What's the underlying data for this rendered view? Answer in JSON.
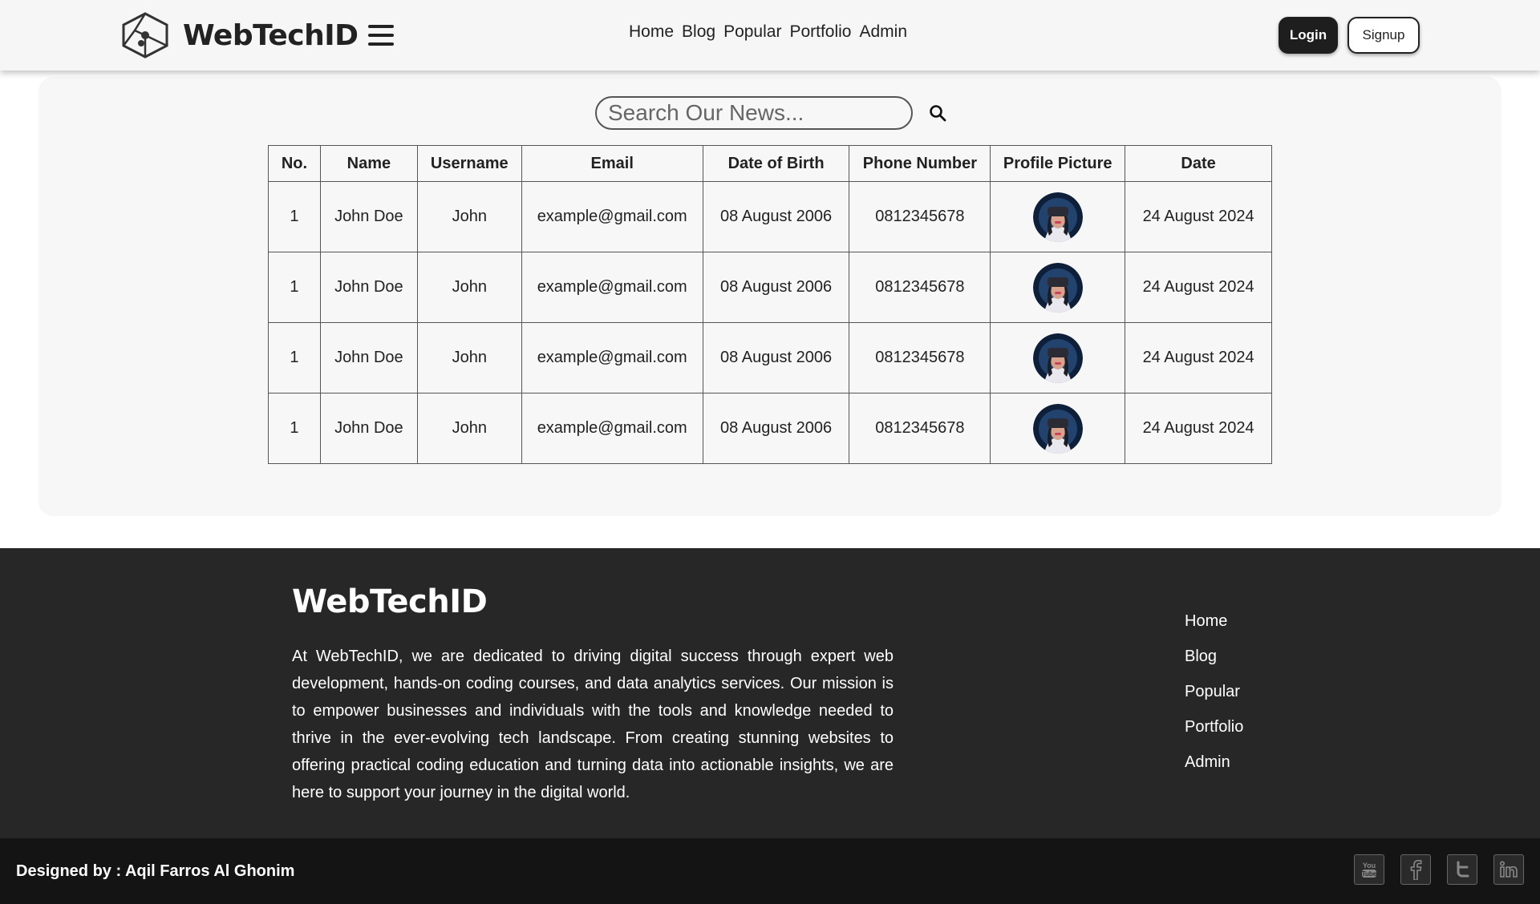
{
  "header": {
    "brand": "WebTechID",
    "nav": [
      "Home",
      "Blog",
      "Popular",
      "Portfolio",
      "Admin"
    ],
    "login_label": "Login",
    "signup_label": "Signup"
  },
  "search": {
    "placeholder": "Search Our News..."
  },
  "table": {
    "headers": [
      "No.",
      "Name",
      "Username",
      "Email",
      "Date of Birth",
      "Phone Number",
      "Profile Picture",
      "Date"
    ],
    "rows": [
      {
        "no": "1",
        "name": "John Doe",
        "username": "John",
        "email": "example@gmail.com",
        "dob": "08 August 2006",
        "phone": "0812345678",
        "date": "24 August 2024"
      },
      {
        "no": "1",
        "name": "John Doe",
        "username": "John",
        "email": "example@gmail.com",
        "dob": "08 August 2006",
        "phone": "0812345678",
        "date": "24 August 2024"
      },
      {
        "no": "1",
        "name": "John Doe",
        "username": "John",
        "email": "example@gmail.com",
        "dob": "08 August 2006",
        "phone": "0812345678",
        "date": "24 August 2024"
      },
      {
        "no": "1",
        "name": "John Doe",
        "username": "John",
        "email": "example@gmail.com",
        "dob": "08 August 2006",
        "phone": "0812345678",
        "date": "24 August 2024"
      }
    ]
  },
  "footer": {
    "brand": "WebTechID",
    "about": "At WebTechID, we are dedicated to driving digital success through expert web development, hands-on coding courses, and data analytics services. Our mission is to empower businesses and individuals with the tools and knowledge needed to thrive in the ever-evolving tech landscape. From creating stunning websites to offering practical coding education and turning data into actionable insights, we are here to support your journey in the digital world.",
    "links": [
      "Home",
      "Blog",
      "Popular",
      "Portfolio",
      "Admin"
    ],
    "credit": "Designed by : Aqil Farros Al Ghonim",
    "social": [
      "youtube-icon",
      "facebook-icon",
      "twitter-icon",
      "linkedin-icon"
    ]
  }
}
